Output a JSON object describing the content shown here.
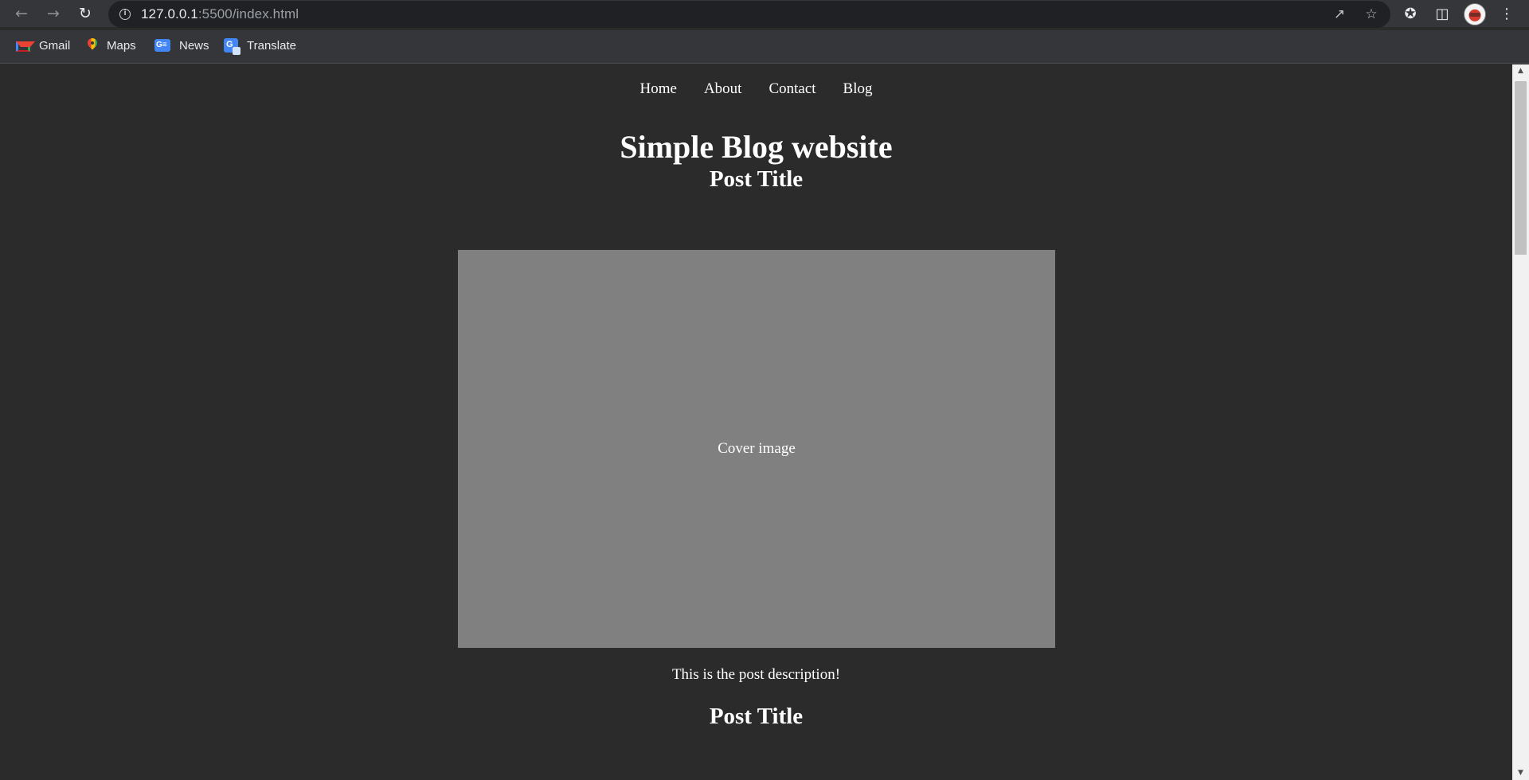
{
  "browser": {
    "url_host": "127.0.0.1",
    "url_rest": ":5500/index.html",
    "bookmarks": [
      {
        "label": "Gmail",
        "icon": "gmail-icon"
      },
      {
        "label": "Maps",
        "icon": "maps-icon"
      },
      {
        "label": "News",
        "icon": "news-icon"
      },
      {
        "label": "Translate",
        "icon": "translate-icon"
      }
    ]
  },
  "page": {
    "nav": [
      "Home",
      "About",
      "Contact",
      "Blog"
    ],
    "title": "Simple Blog website",
    "posts": [
      {
        "title": "Post Title",
        "cover_label": "Cover image",
        "description": "This is the post description!"
      },
      {
        "title": "Post Title"
      }
    ],
    "background": "#2b2b2b",
    "cover_color": "#808080"
  }
}
